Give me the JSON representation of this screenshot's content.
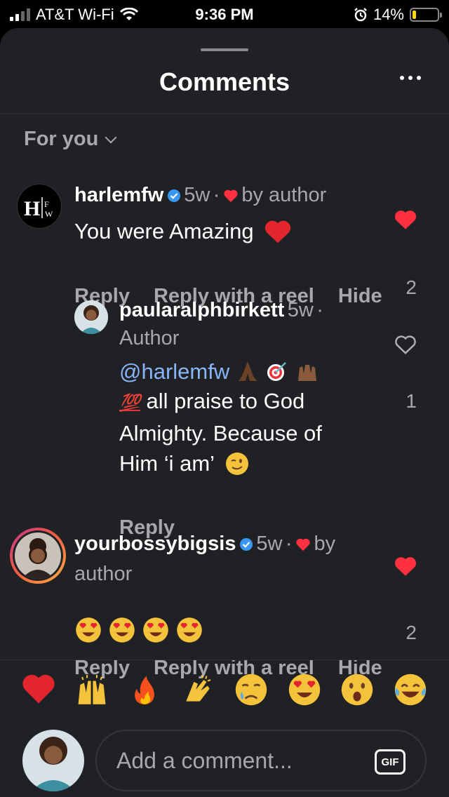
{
  "status_bar": {
    "carrier": "AT&T Wi-Fi",
    "time": "9:36 PM",
    "battery": "14%",
    "battery_level": 0.14
  },
  "sheet": {
    "title": "Comments",
    "filter_label": "For you"
  },
  "comments": [
    {
      "username": "harlemfw",
      "time": "5w",
      "by_author": "by author",
      "text": "You were Amazing",
      "actions": [
        "Reply",
        "Reply with a reel",
        "Hide"
      ],
      "likes": "2",
      "avatar_text": "H|FW"
    },
    {
      "username": "paularalphbirkett",
      "time": "5w",
      "author_tag": "Author",
      "mention": "@harlemfw",
      "text_line2": "all praise to God",
      "text_line3": "Almighty. Because of",
      "text_line4": "Him ‘i am’",
      "actions": [
        "Reply"
      ],
      "likes": "1"
    },
    {
      "username": "yourbossybigsis",
      "time": "5w",
      "by_label": "by",
      "author_word": "author",
      "actions": [
        "Reply",
        "Reply with a reel",
        "Hide"
      ],
      "likes": "2"
    }
  ],
  "emoji_bar": [
    "red-heart",
    "raising-hands",
    "fire",
    "clapping-hands",
    "crying-face",
    "heart-eyes",
    "astonished-face",
    "tears-of-joy"
  ],
  "composer": {
    "placeholder": "Add a comment...",
    "gif_label": "GIF"
  },
  "colors": {
    "background": "#202124",
    "heart": "#ff3040",
    "verified": "#3897f0",
    "mention": "#8ab4f8"
  }
}
